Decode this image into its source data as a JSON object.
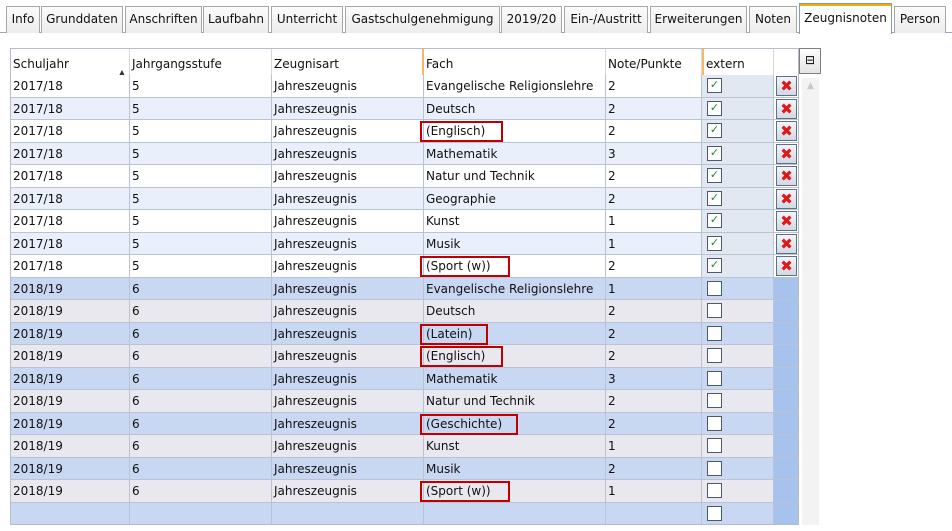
{
  "tabs": [
    {
      "label": "Info",
      "active": false
    },
    {
      "label": "Grunddaten",
      "active": false
    },
    {
      "label": "Anschriften",
      "active": false
    },
    {
      "label": "Laufbahn",
      "active": false
    },
    {
      "label": "Unterricht",
      "active": false
    },
    {
      "label": "Gastschulgenehmigung",
      "active": false
    },
    {
      "label": "2019/20",
      "active": false
    },
    {
      "label": "Ein-/Austritt",
      "active": false
    },
    {
      "label": "Erweiterungen",
      "active": false
    },
    {
      "label": "Noten",
      "active": false
    },
    {
      "label": "Zeugnisnoten",
      "active": true
    },
    {
      "label": "Person",
      "active": false
    }
  ],
  "grid": {
    "columns": [
      "Schuljahr",
      "Jahrgangsstufe",
      "Zeugnisart",
      "Fach",
      "Note/Punkte",
      "extern"
    ],
    "sort_column": "Schuljahr",
    "sort_direction": "ascending",
    "rows": [
      {
        "schuljahr": "2017/18",
        "stufe": "5",
        "art": "Jahreszeugnis",
        "fach": "Evangelische Religionslehre",
        "note": "2",
        "extern": true,
        "deletable": true,
        "highlighted": false
      },
      {
        "schuljahr": "2017/18",
        "stufe": "5",
        "art": "Jahreszeugnis",
        "fach": "Deutsch",
        "note": "2",
        "extern": true,
        "deletable": true,
        "highlighted": false
      },
      {
        "schuljahr": "2017/18",
        "stufe": "5",
        "art": "Jahreszeugnis",
        "fach": "(Englisch)",
        "note": "2",
        "extern": true,
        "deletable": true,
        "highlighted": true
      },
      {
        "schuljahr": "2017/18",
        "stufe": "5",
        "art": "Jahreszeugnis",
        "fach": "Mathematik",
        "note": "3",
        "extern": true,
        "deletable": true,
        "highlighted": false
      },
      {
        "schuljahr": "2017/18",
        "stufe": "5",
        "art": "Jahreszeugnis",
        "fach": "Natur und Technik",
        "note": "2",
        "extern": true,
        "deletable": true,
        "highlighted": false
      },
      {
        "schuljahr": "2017/18",
        "stufe": "5",
        "art": "Jahreszeugnis",
        "fach": "Geographie",
        "note": "2",
        "extern": true,
        "deletable": true,
        "highlighted": false
      },
      {
        "schuljahr": "2017/18",
        "stufe": "5",
        "art": "Jahreszeugnis",
        "fach": "Kunst",
        "note": "1",
        "extern": true,
        "deletable": true,
        "highlighted": false
      },
      {
        "schuljahr": "2017/18",
        "stufe": "5",
        "art": "Jahreszeugnis",
        "fach": "Musik",
        "note": "1",
        "extern": true,
        "deletable": true,
        "highlighted": false
      },
      {
        "schuljahr": "2017/18",
        "stufe": "5",
        "art": "Jahreszeugnis",
        "fach": "(Sport (w))",
        "note": "2",
        "extern": true,
        "deletable": true,
        "highlighted": true
      },
      {
        "schuljahr": "2018/19",
        "stufe": "6",
        "art": "Jahreszeugnis",
        "fach": "Evangelische Religionslehre",
        "note": "1",
        "extern": false,
        "deletable": false,
        "highlighted": false
      },
      {
        "schuljahr": "2018/19",
        "stufe": "6",
        "art": "Jahreszeugnis",
        "fach": "Deutsch",
        "note": "2",
        "extern": false,
        "deletable": false,
        "highlighted": false
      },
      {
        "schuljahr": "2018/19",
        "stufe": "6",
        "art": "Jahreszeugnis",
        "fach": "(Latein)",
        "note": "2",
        "extern": false,
        "deletable": false,
        "highlighted": true
      },
      {
        "schuljahr": "2018/19",
        "stufe": "6",
        "art": "Jahreszeugnis",
        "fach": "(Englisch)",
        "note": "2",
        "extern": false,
        "deletable": false,
        "highlighted": true
      },
      {
        "schuljahr": "2018/19",
        "stufe": "6",
        "art": "Jahreszeugnis",
        "fach": "Mathematik",
        "note": "3",
        "extern": false,
        "deletable": false,
        "highlighted": false
      },
      {
        "schuljahr": "2018/19",
        "stufe": "6",
        "art": "Jahreszeugnis",
        "fach": "Natur und Technik",
        "note": "2",
        "extern": false,
        "deletable": false,
        "highlighted": false
      },
      {
        "schuljahr": "2018/19",
        "stufe": "6",
        "art": "Jahreszeugnis",
        "fach": "(Geschichte)",
        "note": "2",
        "extern": false,
        "deletable": false,
        "highlighted": true
      },
      {
        "schuljahr": "2018/19",
        "stufe": "6",
        "art": "Jahreszeugnis",
        "fach": "Kunst",
        "note": "1",
        "extern": false,
        "deletable": false,
        "highlighted": false
      },
      {
        "schuljahr": "2018/19",
        "stufe": "6",
        "art": "Jahreszeugnis",
        "fach": "Musik",
        "note": "2",
        "extern": false,
        "deletable": false,
        "highlighted": false
      },
      {
        "schuljahr": "2018/19",
        "stufe": "6",
        "art": "Jahreszeugnis",
        "fach": "(Sport (w))",
        "note": "1",
        "extern": false,
        "deletable": false,
        "highlighted": true
      },
      {
        "schuljahr": "",
        "stufe": "",
        "art": "",
        "fach": "",
        "note": "",
        "extern": false,
        "deletable": false,
        "highlighted": false
      }
    ]
  },
  "icons": {
    "delete": "delete-x-icon",
    "column_chooser": "column-chooser-icon",
    "sort": "sort-ascending-icon",
    "checkmark": "checkmark-icon"
  },
  "colors": {
    "row_white": "#ffffff",
    "row_light": "#eaf0fb",
    "row_blue": "#c8d7f2",
    "row_gray": "#e8e8ee",
    "highlight_border": "#c00000",
    "delete_red": "#e01818",
    "extern_col_blue": "#e2e8f2",
    "extern_col_strong": "#a8c2ee"
  }
}
